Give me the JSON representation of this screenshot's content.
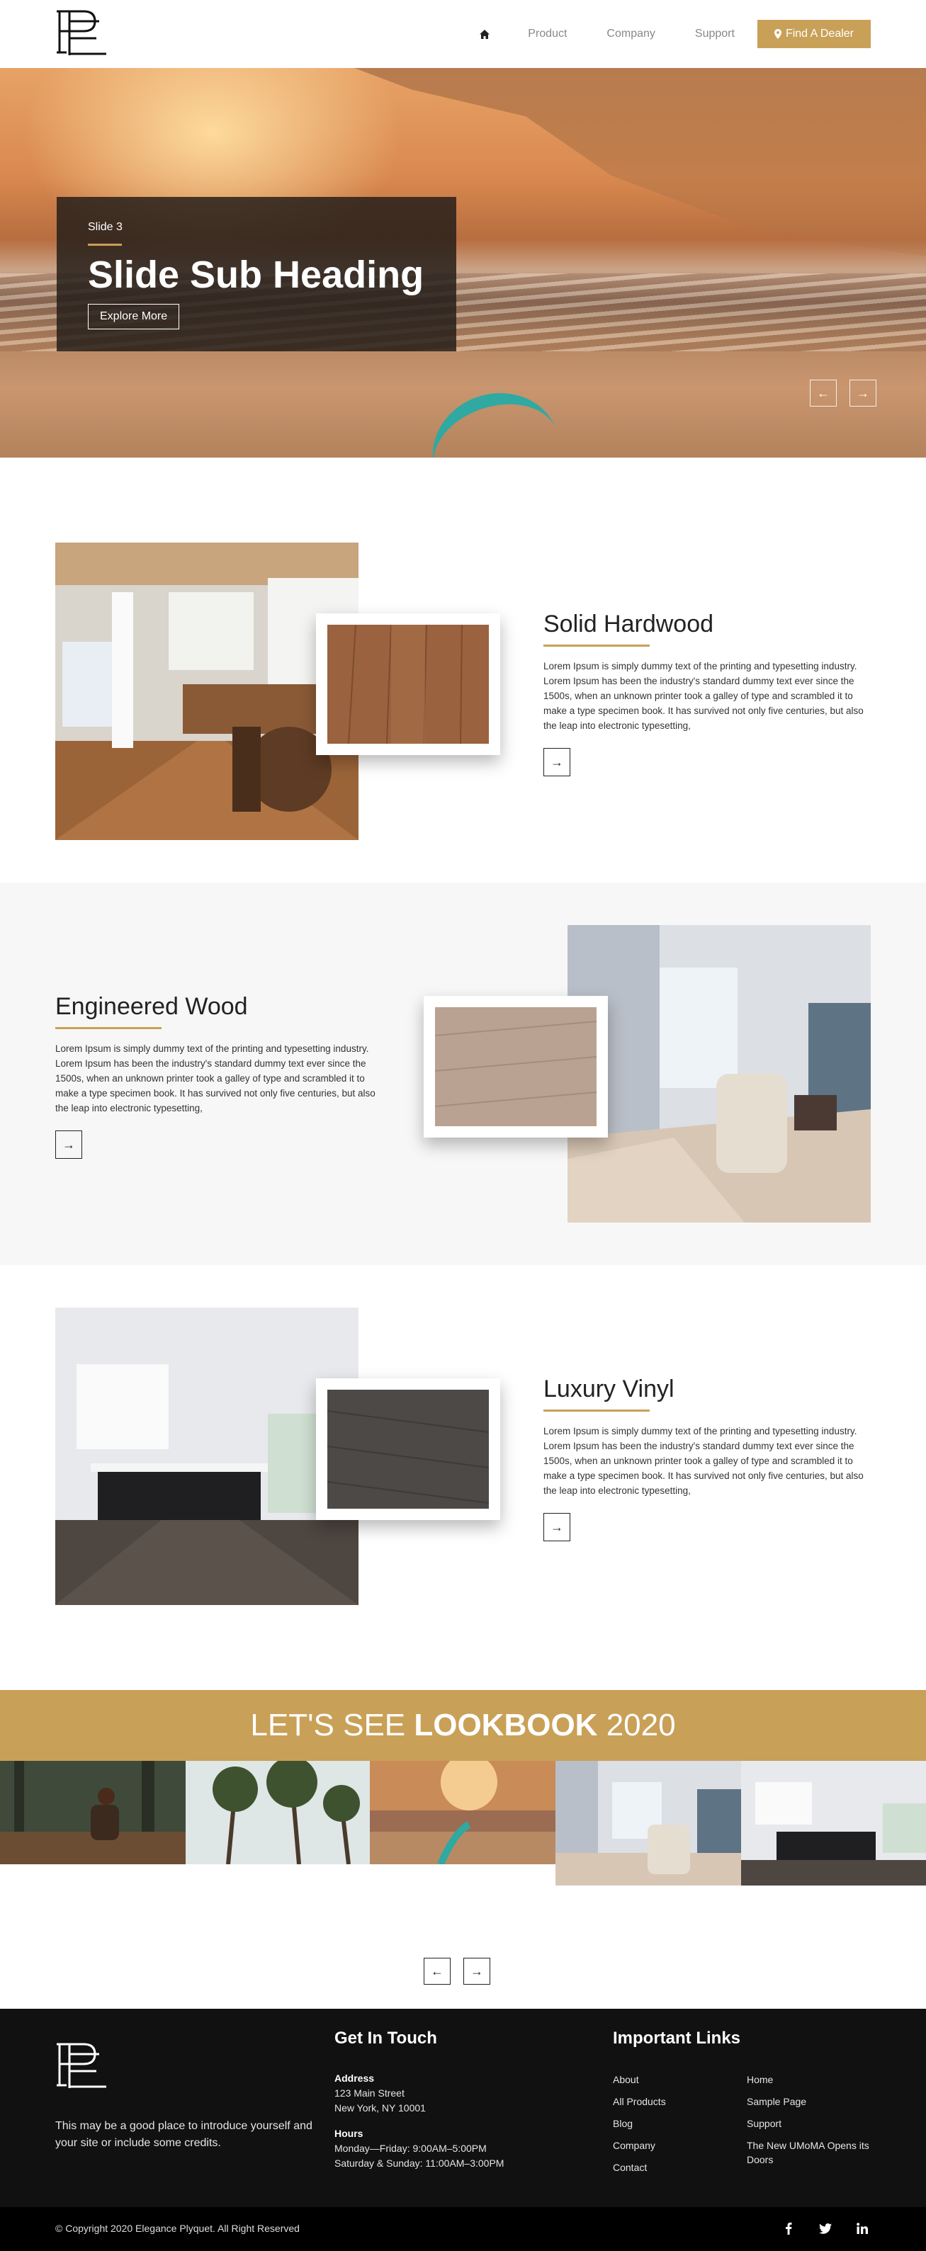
{
  "header": {
    "nav": [
      {
        "label": "Product"
      },
      {
        "label": "Company"
      },
      {
        "label": "Support"
      }
    ],
    "dealer_button": "Find A Dealer",
    "accent": "#c9a057"
  },
  "hero": {
    "slide_label": "Slide 3",
    "title": "Slide Sub Heading",
    "button": "Explore More",
    "prev_glyph": "←",
    "next_glyph": "→"
  },
  "products": [
    {
      "title": "Solid Hardwood",
      "text": "Lorem Ipsum is simply dummy text of the printing and typesetting industry. Lorem Ipsum has been the industry's standard dummy text ever since the 1500s, when an unknown printer took a galley of type and scrambled it to make a type specimen book. It has survived not only five centuries, but also the leap into electronic typesetting,",
      "button_glyph": "→"
    },
    {
      "title": "Engineered Wood",
      "text": "Lorem Ipsum is simply dummy text of the printing and typesetting industry. Lorem Ipsum has been the industry's standard dummy text ever since the 1500s, when an unknown printer took a galley of type and scrambled it to make a type specimen book. It has survived not only five centuries, but also the leap into electronic typesetting,",
      "button_glyph": "→"
    },
    {
      "title": "Luxury Vinyl",
      "text": "Lorem Ipsum is simply dummy text of the printing and typesetting industry. Lorem Ipsum has been the industry's standard dummy text ever since the 1500s, when an unknown printer took a galley of type and scrambled it to make a type specimen book. It has survived not only five centuries, but also the leap into electronic typesetting,",
      "button_glyph": "→"
    }
  ],
  "lookbook": {
    "prefix": "LET'S SEE ",
    "bold": "LOOKBOOK",
    "suffix": " 2020",
    "prev_glyph": "←",
    "next_glyph": "→"
  },
  "footer": {
    "intro": "This may be a good place to introduce yourself and your site or include some credits.",
    "contact_heading": "Get In Touch",
    "address_label": "Address",
    "address_line1": "123 Main Street",
    "address_line2": "New York, NY 10001",
    "hours_label": "Hours",
    "hours_line1": "Monday—Friday: 9:00AM–5:00PM",
    "hours_line2": "Saturday & Sunday: 11:00AM–3:00PM",
    "links_heading": "Important Links",
    "links_col1": [
      "About",
      "All Products",
      "Blog",
      "Company",
      "Contact"
    ],
    "links_col2": [
      "Home",
      "Sample Page",
      "Support",
      "The New UMoMA Opens its Doors"
    ],
    "copyright": "© Copyright 2020 Elegance Plyquet. All Right Reserved",
    "social_icons": [
      "facebook-icon",
      "twitter-icon",
      "linkedin-icon"
    ]
  }
}
